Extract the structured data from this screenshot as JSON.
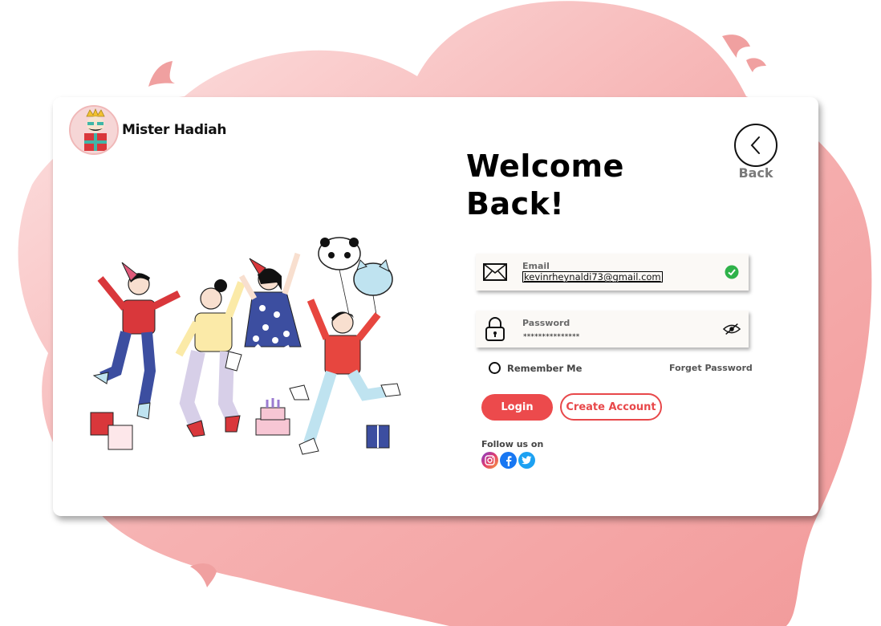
{
  "brand": {
    "name": "Mister Hadiah"
  },
  "heading": {
    "line1": "Welcome",
    "line2": "Back!"
  },
  "back": {
    "label": "Back"
  },
  "email": {
    "label": "Email",
    "value": "kevinrheynaldi73@gmail.com",
    "status": "valid",
    "status_color": "#2fb24a"
  },
  "password": {
    "label": "Password",
    "masked_value": "***************"
  },
  "remember": {
    "label": "Remember Me",
    "checked": false
  },
  "forget": {
    "label": "Forget Password"
  },
  "buttons": {
    "login": "Login",
    "create": "Create Account"
  },
  "follow": {
    "label": "Follow us on",
    "networks": [
      "instagram-icon",
      "facebook-icon",
      "twitter-icon"
    ]
  },
  "colors": {
    "accent": "#ec4a4c",
    "blob": "#f4a5a5"
  }
}
